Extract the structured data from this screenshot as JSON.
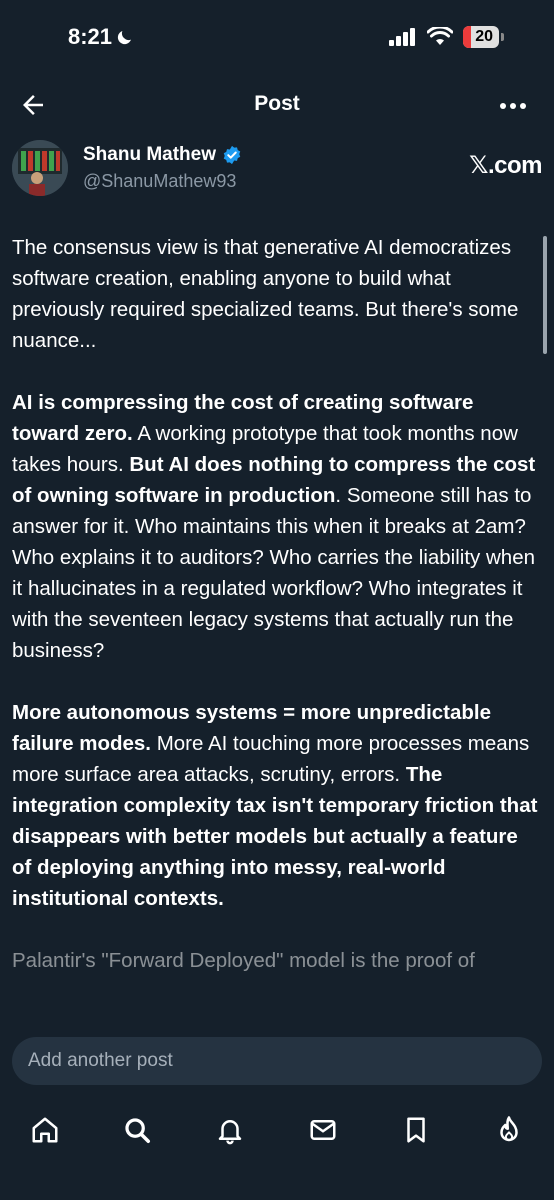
{
  "status_bar": {
    "time": "8:21",
    "battery_level": "20"
  },
  "header": {
    "title": "Post"
  },
  "author": {
    "name": "Shanu Mathew",
    "handle": "@ShanuMathew93",
    "source": "𝕏.com"
  },
  "post": {
    "p1": "The consensus view is that generative AI democratizes software creation, enabling anyone to build what previously required specialized teams. But there's some nuance...",
    "p2_b1": "AI is compressing the cost of creating software toward zero.",
    "p2_t1": " A working prototype that took months now takes hours. ",
    "p2_b2": "But AI does nothing to compress the cost of owning software in production",
    "p2_t2": ". Someone still has to answer for it. Who maintains this when it breaks at 2am? Who explains it to auditors? Who carries the liability when it hallucinates in a regulated workflow? Who integrates it with the seventeen legacy systems that actually run the business?",
    "p3_b1": "More autonomous systems = more unpredictable failure modes.",
    "p3_t1": " More AI touching more processes means more surface area attacks, scrutiny, errors. ",
    "p3_b2": "The integration complexity tax isn't temporary friction that disappears with better models but actually a feature of deploying anything into messy, real-world institutional contexts.",
    "p4": "Palantir's \"Forward Deployed\" model is the proof of"
  },
  "composer": {
    "placeholder": "Add another post"
  },
  "bottom_nav": {
    "tabs": [
      "home-icon",
      "search-icon",
      "notifications-icon",
      "messages-icon",
      "bookmarks-icon",
      "grok-icon"
    ]
  },
  "colors": {
    "background": "#15202b",
    "composer": "#253341",
    "muted_text": "#8b98a5",
    "verified": "#1d9bf0"
  }
}
